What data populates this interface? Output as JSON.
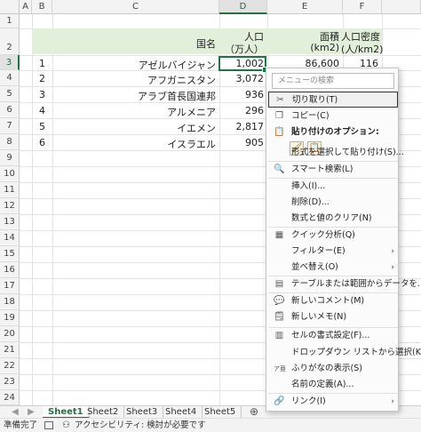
{
  "columns": [
    "A",
    "B",
    "C",
    "D",
    "E",
    "F"
  ],
  "rows": [
    "1",
    "2",
    "3",
    "4",
    "5",
    "6",
    "7",
    "8",
    "9",
    "10",
    "11",
    "12",
    "13",
    "14",
    "15",
    "16",
    "17",
    "18",
    "19",
    "20",
    "21",
    "22",
    "23",
    "24"
  ],
  "table": {
    "header_name": "国名",
    "header_pop_1": "人口",
    "header_pop_2": "（万人）",
    "header_area_1": "面積",
    "header_area_2": "(km2)",
    "header_density_1": "人口密度",
    "header_density_2": "(人/km2)",
    "data": [
      {
        "no": "1",
        "name": "アゼルバイジャン",
        "pop": "1,002",
        "area": "86,600",
        "density": "116"
      },
      {
        "no": "2",
        "name": "アフガニスタン",
        "pop": "3,072",
        "area": "",
        "density": ""
      },
      {
        "no": "3",
        "name": "アラブ首長国連邦",
        "pop": "936",
        "area": "",
        "density": ""
      },
      {
        "no": "4",
        "name": "アルメニア",
        "pop": "296",
        "area": "",
        "density": ""
      },
      {
        "no": "5",
        "name": "イエメン",
        "pop": "2,817",
        "area": "",
        "density": ""
      },
      {
        "no": "6",
        "name": "イスラエル",
        "pop": "905",
        "area": "",
        "density": ""
      }
    ]
  },
  "sheets": [
    "Sheet1",
    "Sheet2",
    "Sheet3",
    "Sheet4",
    "Sheet5"
  ],
  "status": {
    "ready": "準備完了",
    "accessibility": "アクセシビリティ: 検討が必要です"
  },
  "menu": {
    "search_placeholder": "メニューの検索",
    "cut": "切り取り(T)",
    "copy": "コピー(C)",
    "paste_options": "貼り付けのオプション:",
    "paste_special": "形式を選択して貼り付け(S)...",
    "smart_lookup": "スマート検索(L)",
    "insert": "挿入(I)...",
    "delete": "削除(D)...",
    "clear": "数式と値のクリア(N)",
    "quick_analysis": "クイック分析(Q)",
    "filter": "フィルター(E)",
    "sort": "並べ替え(O)",
    "table_from_range": "テーブルまたは範囲からデータを...",
    "new_comment": "新しいコメント(M)",
    "new_note": "新しいメモ(N)",
    "format_cells": "セルの書式設定(F)...",
    "pick_from_list": "ドロップダウン リストから選択(K)...",
    "show_phonetic": "ふりがなの表示(S)",
    "define_name": "名前の定義(A)...",
    "link": "リンク(I)"
  },
  "colors": {
    "accent": "#217346",
    "header_band": "#e2efda"
  }
}
